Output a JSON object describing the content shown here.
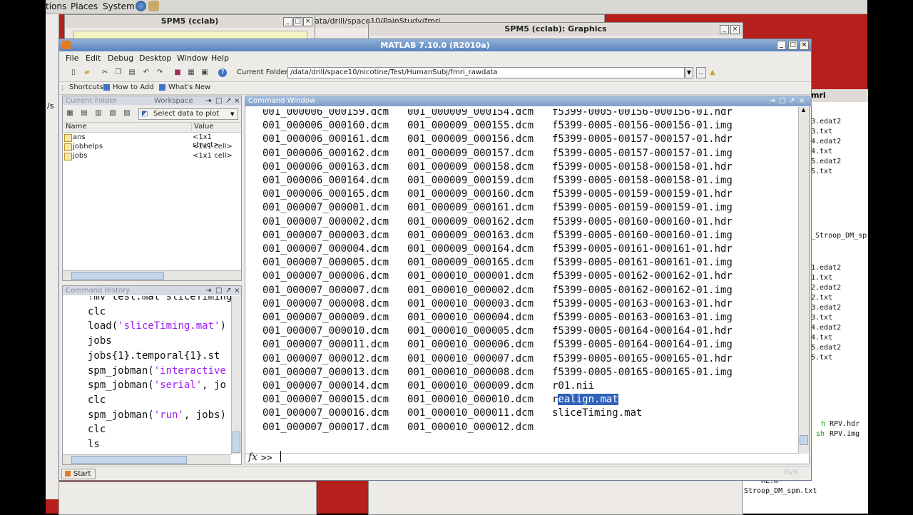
{
  "gnome": {
    "places": "Places",
    "system": "System",
    "tions": "tions"
  },
  "bg_windows": {
    "spm_left": "SPM5 (cclab)",
    "spm_graphics": "SPM5 (cclab): Graphics",
    "path_title": "ata/drill/space10/PainStudy/fmri",
    "right_title": "mri",
    "right_files": [
      "3.edat2",
      "3.txt",
      "4.edat2",
      "4.txt",
      "5.edat2",
      "5.txt",
      "_Stroop_DM_sp",
      "1.edat2",
      "1.txt",
      "2.edat2",
      "2.txt",
      "3.edat2",
      "3.txt",
      "4.edat2",
      "4.txt",
      "5.edat2",
      "5.txt"
    ],
    "right_rpv": [
      "h",
      "RPV.hdr",
      "sh",
      "RPV.img"
    ],
    "bottom_files": [
      "RL.m~",
      "Stroop_DM_spm.txt"
    ],
    "left_frag": "/s"
  },
  "matlab": {
    "title": "MATLAB  7.10.0 (R2010a)",
    "menu": [
      "File",
      "Edit",
      "Debug",
      "Desktop",
      "Window",
      "Help"
    ],
    "current_folder_label": "Current Folder:",
    "current_folder": "/data/drill/space10/nicotine/Test/HumanSubj/fmri_rawdata",
    "shortcuts": {
      "shortcuts": "Shortcuts",
      "how_to_add": "How to Add",
      "whats_new": "What's New"
    },
    "workspace": {
      "tab_current_folder": "Current Folder",
      "tab_workspace": "Workspace",
      "select_plot": "Select data to plot",
      "col_name": "Name",
      "col_value": "Value",
      "vars": [
        {
          "name": "ans",
          "value": "<1x1 struct>"
        },
        {
          "name": "jobhelps",
          "value": "<1x1 cell>"
        },
        {
          "name": "jobs",
          "value": "<1x1 cell>"
        }
      ]
    },
    "history": {
      "title": "Command History",
      "lines": [
        [
          {
            "t": "!mv test.mat sliceTiming",
            "c": ""
          }
        ],
        [
          {
            "t": "clc",
            "c": ""
          }
        ],
        [
          {
            "t": "load(",
            "c": ""
          },
          {
            "t": "'sliceTiming.mat'",
            "c": "str"
          },
          {
            "t": ")",
            "c": ""
          }
        ],
        [
          {
            "t": "jobs",
            "c": ""
          }
        ],
        [
          {
            "t": "jobs{1}.temporal{1}.st",
            "c": ""
          }
        ],
        [
          {
            "t": "spm_jobman(",
            "c": ""
          },
          {
            "t": "'interactive",
            "c": "str"
          }
        ],
        [
          {
            "t": "spm_jobman(",
            "c": ""
          },
          {
            "t": "'serial'",
            "c": "str"
          },
          {
            "t": ", jo",
            "c": ""
          }
        ],
        [
          {
            "t": "clc",
            "c": ""
          }
        ],
        [
          {
            "t": "spm_jobman(",
            "c": ""
          },
          {
            "t": "'run'",
            "c": "str"
          },
          {
            "t": ", jobs)",
            "c": ""
          }
        ],
        [
          {
            "t": "clc",
            "c": ""
          }
        ],
        [
          {
            "t": "ls",
            "c": ""
          }
        ]
      ]
    },
    "command_window": {
      "title": "Command Window",
      "prompt": ">>",
      "fx": "fx",
      "rows": [
        [
          "001_000006_000159.dcm",
          "001_000009_000154.dcm",
          "f5399-0005-00156-000156-01.hdr"
        ],
        [
          "001_000006_000160.dcm",
          "001_000009_000155.dcm",
          "f5399-0005-00156-000156-01.img"
        ],
        [
          "001_000006_000161.dcm",
          "001_000009_000156.dcm",
          "f5399-0005-00157-000157-01.hdr"
        ],
        [
          "001_000006_000162.dcm",
          "001_000009_000157.dcm",
          "f5399-0005-00157-000157-01.img"
        ],
        [
          "001_000006_000163.dcm",
          "001_000009_000158.dcm",
          "f5399-0005-00158-000158-01.hdr"
        ],
        [
          "001_000006_000164.dcm",
          "001_000009_000159.dcm",
          "f5399-0005-00158-000158-01.img"
        ],
        [
          "001_000006_000165.dcm",
          "001_000009_000160.dcm",
          "f5399-0005-00159-000159-01.hdr"
        ],
        [
          "001_000007_000001.dcm",
          "001_000009_000161.dcm",
          "f5399-0005-00159-000159-01.img"
        ],
        [
          "001_000007_000002.dcm",
          "001_000009_000162.dcm",
          "f5399-0005-00160-000160-01.hdr"
        ],
        [
          "001_000007_000003.dcm",
          "001_000009_000163.dcm",
          "f5399-0005-00160-000160-01.img"
        ],
        [
          "001_000007_000004.dcm",
          "001_000009_000164.dcm",
          "f5399-0005-00161-000161-01.hdr"
        ],
        [
          "001_000007_000005.dcm",
          "001_000009_000165.dcm",
          "f5399-0005-00161-000161-01.img"
        ],
        [
          "001_000007_000006.dcm",
          "001_000010_000001.dcm",
          "f5399-0005-00162-000162-01.hdr"
        ],
        [
          "001_000007_000007.dcm",
          "001_000010_000002.dcm",
          "f5399-0005-00162-000162-01.img"
        ],
        [
          "001_000007_000008.dcm",
          "001_000010_000003.dcm",
          "f5399-0005-00163-000163-01.hdr"
        ],
        [
          "001_000007_000009.dcm",
          "001_000010_000004.dcm",
          "f5399-0005-00163-000163-01.img"
        ],
        [
          "001_000007_000010.dcm",
          "001_000010_000005.dcm",
          "f5399-0005-00164-000164-01.hdr"
        ],
        [
          "001_000007_000011.dcm",
          "001_000010_000006.dcm",
          "f5399-0005-00164-000164-01.img"
        ],
        [
          "001_000007_000012.dcm",
          "001_000010_000007.dcm",
          "f5399-0005-00165-000165-01.hdr"
        ],
        [
          "001_000007_000013.dcm",
          "001_000010_000008.dcm",
          "f5399-0005-00165-000165-01.img"
        ],
        [
          "001_000007_000014.dcm",
          "001_000010_000009.dcm",
          "r01.nii"
        ],
        [
          "001_000007_000015.dcm",
          "001_000010_000010.dcm",
          "realign.mat"
        ],
        [
          "001_000007_000016.dcm",
          "001_000010_000011.dcm",
          "sliceTiming.mat"
        ],
        [
          "001_000007_000017.dcm",
          "001_000010_000012.dcm",
          ""
        ]
      ],
      "selected_prefix": "r",
      "selected_rest": "ealign.mat"
    },
    "status": {
      "start": "Start",
      "ovr": "OVR"
    },
    "colors": {
      "title_bar": "#5a84bc",
      "selection": "#2f62b8",
      "string": "#a020f0",
      "desktop": "#b51f1c"
    }
  }
}
